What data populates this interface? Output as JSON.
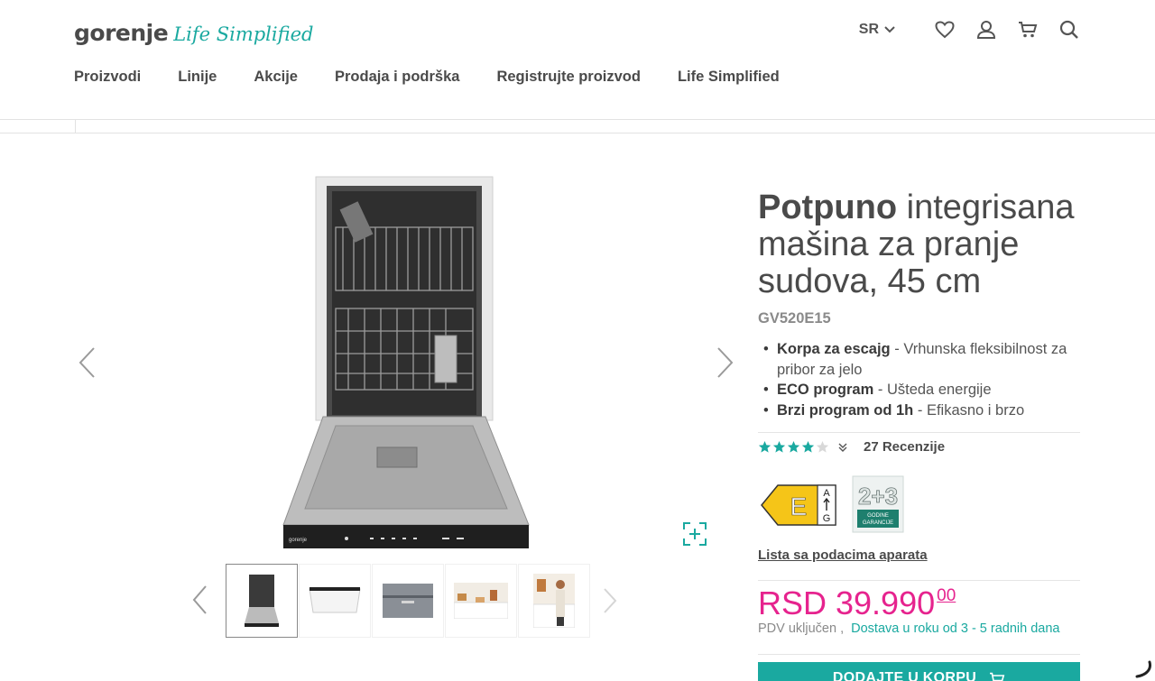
{
  "brand": {
    "name": "gorenje",
    "tagline": "Life Simplified"
  },
  "header": {
    "language": "SR",
    "icons": [
      "chevron-down-icon",
      "heart-icon",
      "user-icon",
      "cart-icon",
      "search-icon"
    ]
  },
  "nav": {
    "items": [
      {
        "label": "Proizvodi"
      },
      {
        "label": "Linije"
      },
      {
        "label": "Akcije"
      },
      {
        "label": "Prodaja i podrška"
      },
      {
        "label": "Registrujte proizvod"
      },
      {
        "label": "Life Simplified"
      }
    ]
  },
  "gallery": {
    "thumbnail_count": 5,
    "active_thumbnail": 1
  },
  "product": {
    "title_bold": "Potpuno",
    "title_rest": "integrisana mašina za pranje sudova, 45 cm",
    "sku": "GV520E15",
    "features": [
      {
        "name": "Korpa za escajg",
        "desc": "Vrhunska fleksibilnost za pribor za jelo"
      },
      {
        "name": "ECO program",
        "desc": "Ušteda energije"
      },
      {
        "name": "Brzi program od 1h",
        "desc": "Efikasno i brzo"
      }
    ],
    "rating": {
      "stars": 4,
      "max": 5,
      "reviews_label": "27 Recenzije"
    },
    "energy_class": "E",
    "energy_scale": [
      "A",
      "G"
    ],
    "warranty": {
      "years": "2+3",
      "label_line1": "GODINE",
      "label_line2": "GARANCIJE"
    },
    "datasheet_link": "Lista sa podacima aparata",
    "price": {
      "currency_amount": "RSD 39.990",
      "cents": "00"
    },
    "delivery": {
      "vat": "PDV uključen ,",
      "info": "Dostava u roku od 3 - 5 radnih dana"
    },
    "add_to_cart": "DODAJTE U KORPU"
  },
  "colors": {
    "accent": "#1aa9a0",
    "price": "#e6238e",
    "energy": "#f5c518"
  }
}
